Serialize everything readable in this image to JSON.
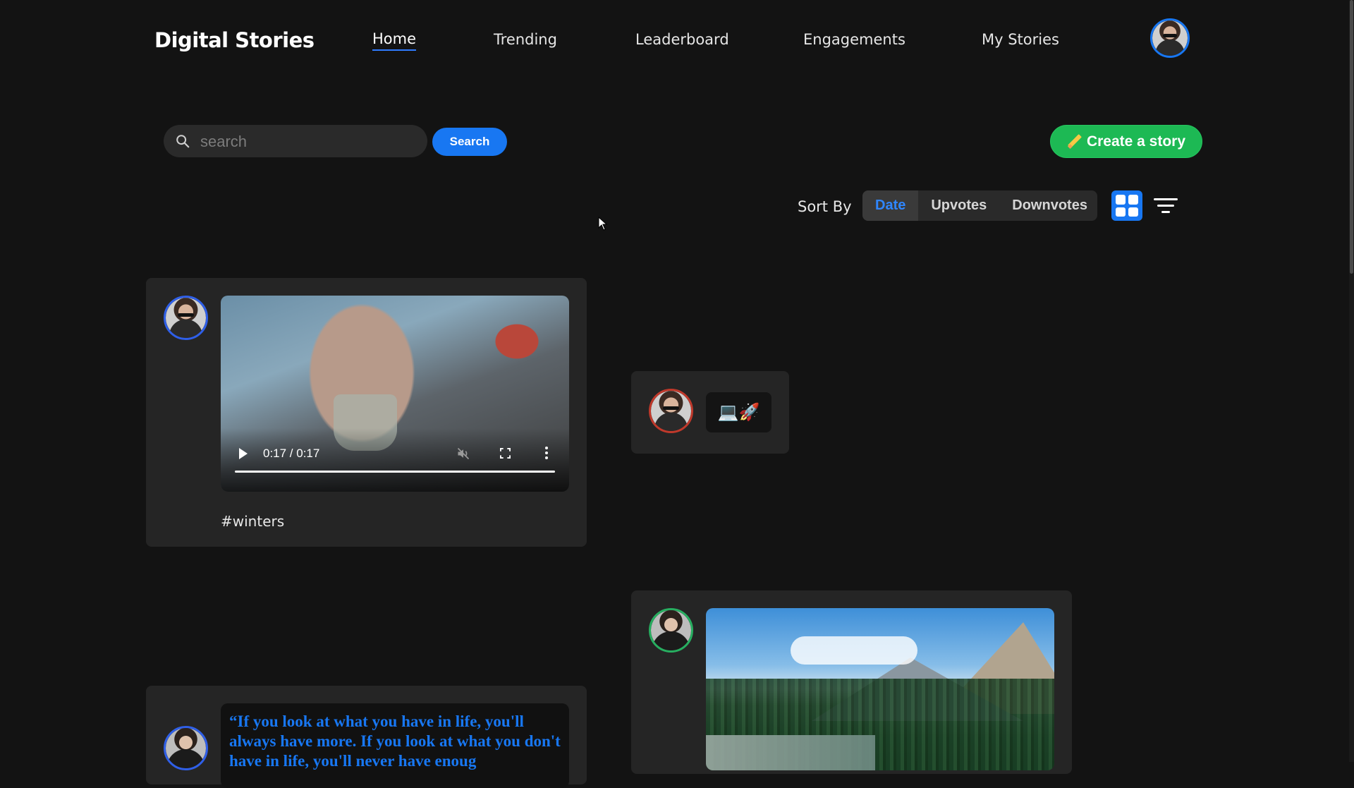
{
  "header": {
    "brand": "Digital Stories",
    "nav": [
      {
        "label": "Home",
        "active": true
      },
      {
        "label": "Trending",
        "active": false
      },
      {
        "label": "Leaderboard",
        "active": false
      },
      {
        "label": "Engagements",
        "active": false
      },
      {
        "label": "My Stories",
        "active": false
      }
    ],
    "avatar_ring_color": "#1877f2"
  },
  "search": {
    "placeholder": "search",
    "value": "",
    "button_label": "Search",
    "icon": "search-icon"
  },
  "create": {
    "label": "Create a story",
    "icon": "pencil-icon",
    "color": "#1db954"
  },
  "sort": {
    "label": "Sort By",
    "options": [
      "Date",
      "Upvotes",
      "Downvotes"
    ],
    "selected": "Date",
    "view_icons": [
      "grid-view-icon",
      "filter-icon"
    ]
  },
  "stories": [
    {
      "type": "video",
      "avatar_ring_color": "#2f5fe8",
      "time": "0:17 / 0:17",
      "progress": 1.0,
      "muted": true,
      "tag": "#winters"
    },
    {
      "type": "emoji",
      "avatar_ring_color": "#c0392b",
      "emojis": "💻🚀"
    },
    {
      "type": "quote",
      "avatar_ring_color": "#2f5fe8",
      "text": "“If you look at what you have in life, you'll always have more. If you look at what you don't have in life, you'll never have enoug"
    },
    {
      "type": "image",
      "avatar_ring_color": "#27ae60",
      "image": "mountain-landscape"
    }
  ],
  "colors": {
    "background": "#131313",
    "card": "#252525",
    "accent": "#1877f2"
  }
}
